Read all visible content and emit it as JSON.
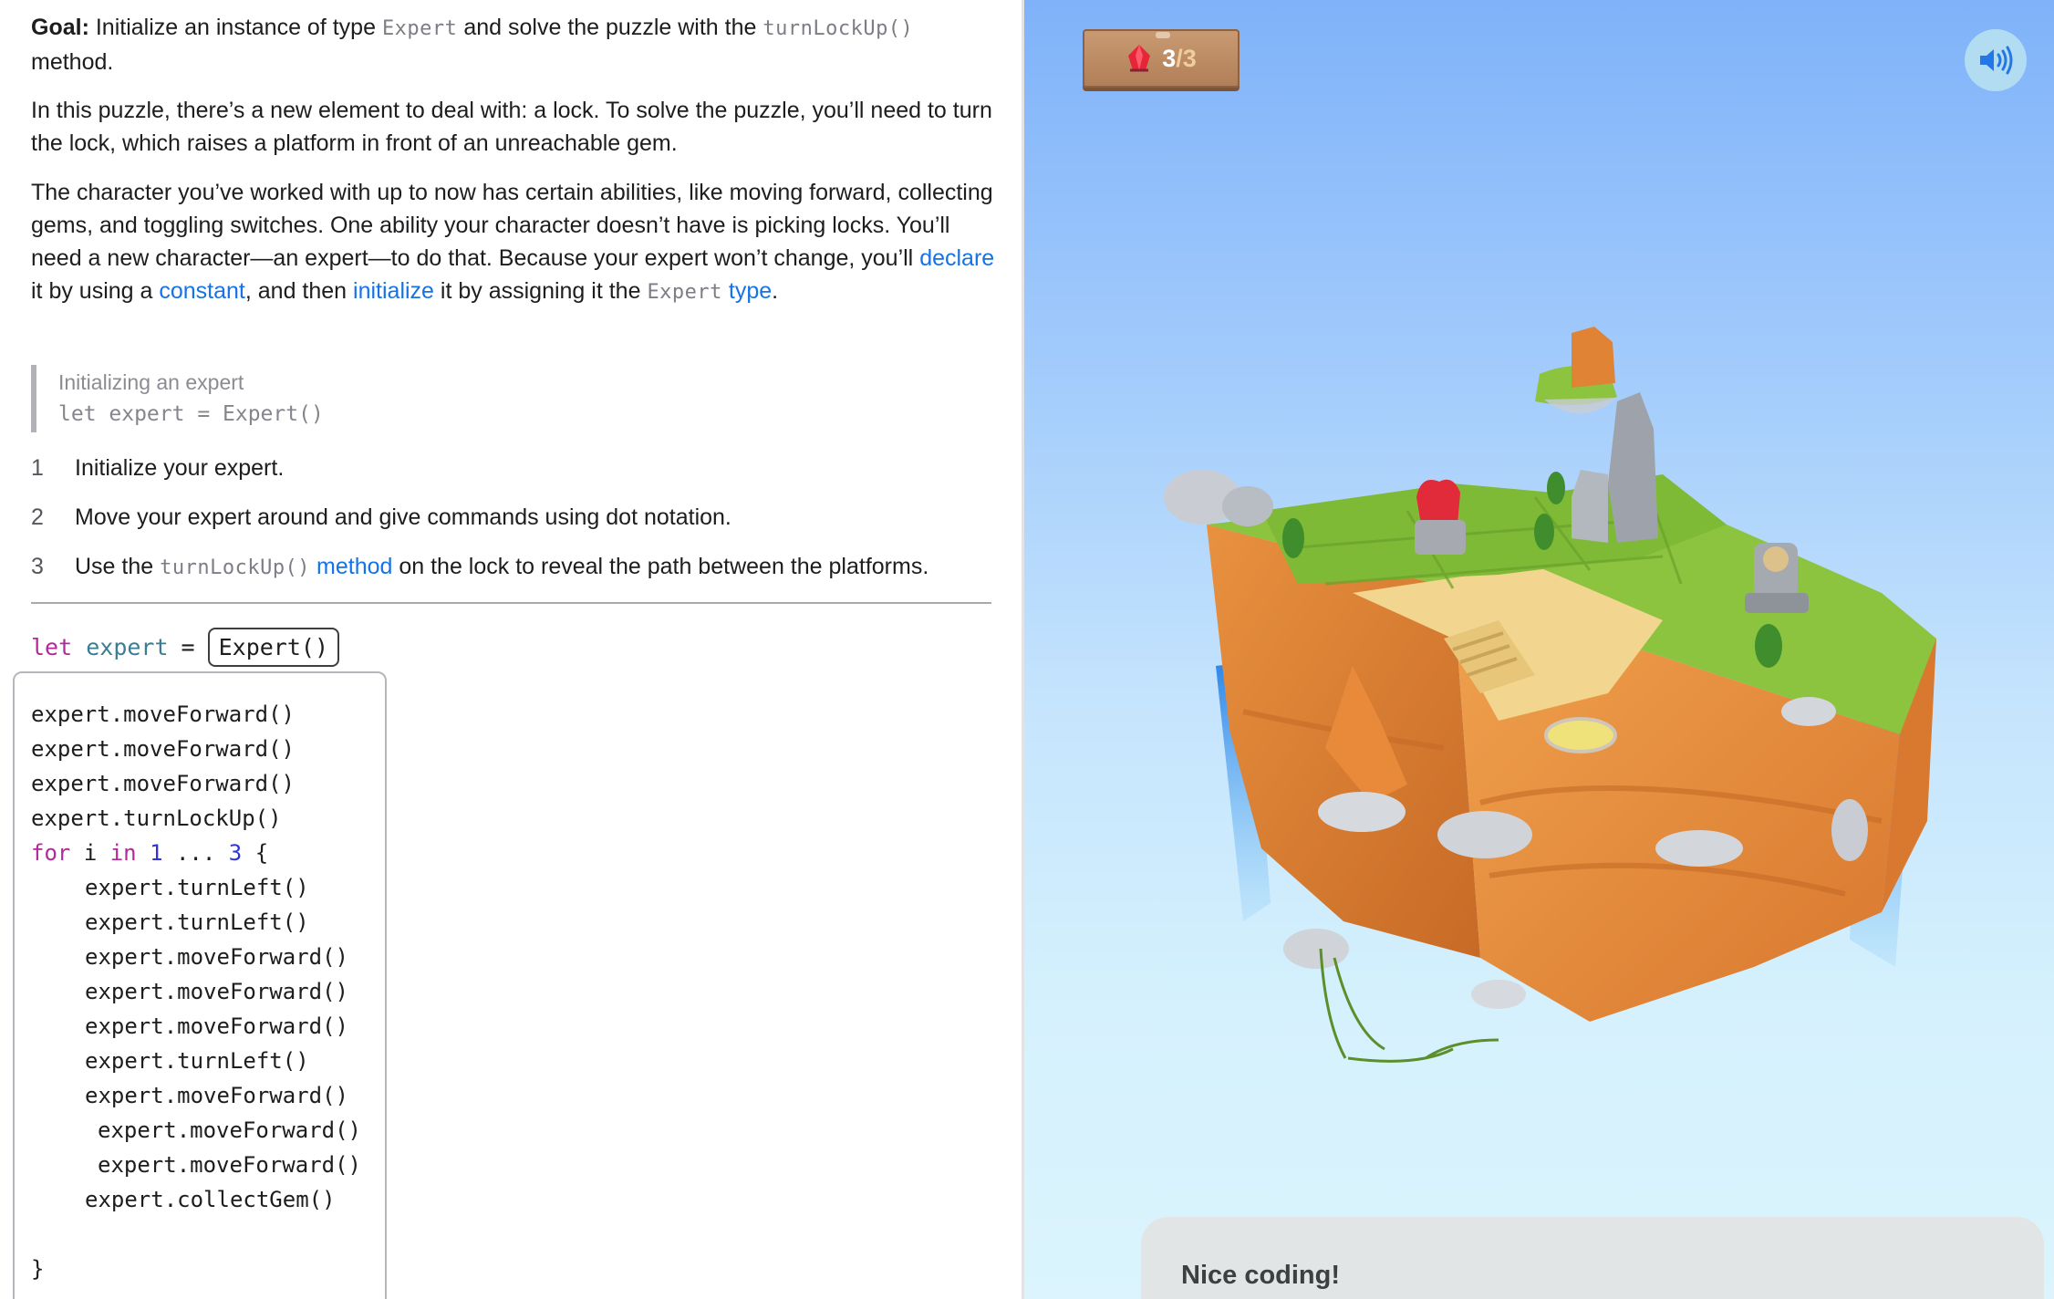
{
  "instructions": {
    "goal_label": "Goal:",
    "goal_text_1": " Initialize an instance of type ",
    "goal_code_1": "Expert",
    "goal_text_2": " and solve the puzzle with the ",
    "goal_code_2": "turnLockUp()",
    "goal_text_3": " method.",
    "intro": "In this puzzle, there’s a new element to deal with: a lock. To solve the puzzle, you’ll need to turn the lock, which raises a platform in front of an unreachable gem.",
    "desc_1": "The character you’ve worked with up to now has certain abilities, like moving forward, collecting gems, and toggling switches. One ability your character doesn’t have is picking locks. You’ll need a new character—an expert—to do that. Because your expert won’t change, you’ll ",
    "desc_link_declare": "declare",
    "desc_2": " it by using a ",
    "desc_link_constant": "constant",
    "desc_3": ", and then ",
    "desc_link_initialize": "initialize",
    "desc_4": " it by assigning it the ",
    "desc_code": "Expert",
    "desc_link_type": "type",
    "desc_5": "."
  },
  "example": {
    "title": "Initializing an expert",
    "code": "let expert = Expert()"
  },
  "steps": [
    {
      "number": "1",
      "text": "Initialize your expert."
    },
    {
      "number": "2",
      "text": "Move your expert around and give commands using dot notation."
    },
    {
      "number": "3",
      "text_1": "Use the ",
      "code": "turnLockUp()",
      "link": "method",
      "text_2": " on the lock to reveal the path between the platforms."
    }
  ],
  "declaration": {
    "keyword": "let",
    "name": "expert",
    "equals": "=",
    "value": "Expert()"
  },
  "code_editor": {
    "lines": [
      "expert.moveForward()",
      "expert.moveForward()",
      "expert.moveForward()",
      "expert.turnLockUp()"
    ],
    "loop": {
      "keyword": "for",
      "var": "i",
      "in": "in",
      "start": "1",
      "range": "...",
      "end": "3",
      "open": "{"
    },
    "loop_body": [
      "expert.turnLeft()",
      "expert.turnLeft()",
      "expert.moveForward()",
      "expert.moveForward()",
      "expert.moveForward()",
      "expert.turnLeft()",
      "expert.moveForward()",
      "expert.moveForward()",
      "expert.moveForward()",
      "expert.collectGem()"
    ],
    "close": "}"
  },
  "hud": {
    "gems_collected": "3",
    "gems_total": "/3",
    "gem_icon": "gem-icon",
    "sound_icon": "speaker-icon"
  },
  "feedback": {
    "message": "Nice coding!"
  },
  "colors": {
    "link": "#1673e6",
    "keyword": "#b2299a",
    "identifier": "#3a7e95",
    "number": "#2f34d6"
  }
}
